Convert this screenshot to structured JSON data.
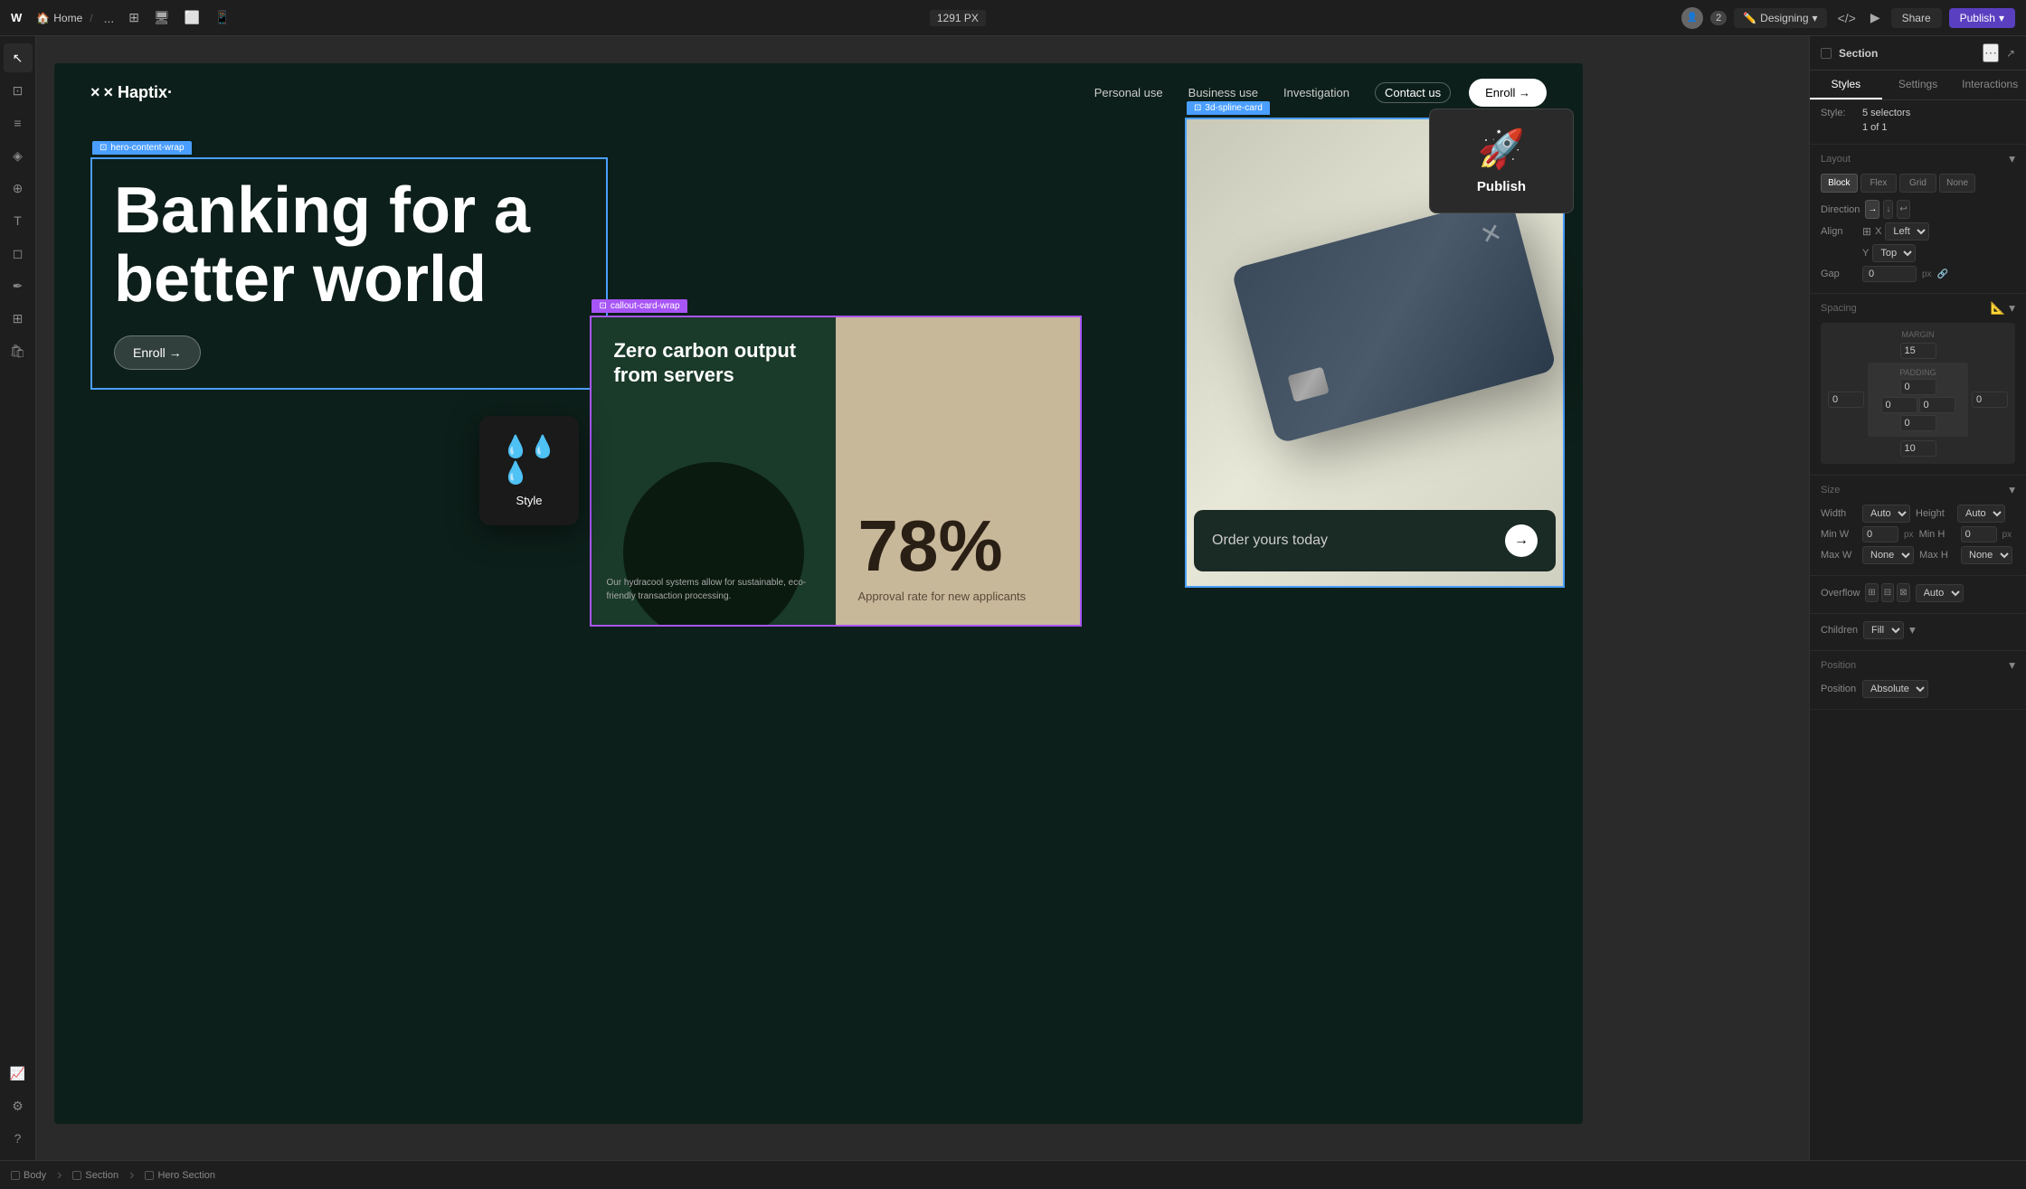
{
  "topbar": {
    "logo": "W",
    "home_label": "Home",
    "more_label": "...",
    "px_label": "1291 PX",
    "user_count": "2",
    "designing_label": "Designing",
    "share_label": "Share",
    "publish_label": "Publish"
  },
  "left_sidebar": {
    "icons": [
      "cursor",
      "frame",
      "layers",
      "component",
      "asset",
      "text",
      "shape",
      "pen",
      "comment",
      "plugin",
      "settings"
    ]
  },
  "canvas": {
    "selection_labels": {
      "hero_content_wrap": "hero-content-wrap",
      "callout_card_wrap": "callout-card-wrap",
      "spline_card": "3d-spline-card"
    },
    "website": {
      "nav": {
        "logo": "× Haptix·",
        "links": [
          "Personal use",
          "Business use",
          "Investigation",
          "Contact us"
        ],
        "enroll_btn": "Enroll →"
      },
      "hero": {
        "title": "Banking for a better world",
        "enroll_btn": "Enroll →"
      },
      "cards": {
        "green_card": {
          "title": "Zero carbon output from servers",
          "body": "Our hydracool systems allow for sustainable, eco-friendly transaction processing."
        },
        "tan_card": {
          "percentage": "78%",
          "label": "Approval rate for new applicants"
        },
        "order_card": {
          "text": "Order yours today",
          "btn_arrow": "→"
        }
      }
    }
  },
  "style_popup": {
    "icon": "💧💧\n💧",
    "label": "Style"
  },
  "publish_popup": {
    "icon_label": "rocket",
    "label": "Publish"
  },
  "right_panel": {
    "title": "Section",
    "tabs": [
      "Styles",
      "Settings",
      "Interactions"
    ],
    "style_selector": "5 selectors",
    "counts": {
      "one_of": "1 of 1"
    },
    "layout": {
      "title": "Layout",
      "display_options": [
        "Block",
        "Flex",
        "Grid",
        "None"
      ],
      "direction_label": "Direction",
      "align_label": "Align",
      "x_align": "Left",
      "y_align": "Top",
      "gap_label": "Gap",
      "gap_value": "0"
    },
    "spacing": {
      "title": "Spacing",
      "margin_label": "MARGIN",
      "margin_top": "15",
      "margin_right": "0",
      "margin_bottom": "10",
      "margin_left": "0",
      "padding_label": "PADDING",
      "padding_top": "0",
      "padding_right": "0",
      "padding_bottom": "0",
      "padding_left": "0"
    },
    "size": {
      "title": "Size",
      "width_label": "Width",
      "width_value": "Auto",
      "height_label": "Height",
      "height_value": "Auto",
      "min_w_label": "Min W",
      "min_w_value": "0",
      "min_h_label": "Min H",
      "min_h_value": "0",
      "max_w_label": "Max W",
      "max_w_value": "None",
      "max_h_label": "Max H",
      "max_h_value": "None"
    },
    "overflow": {
      "title": "Overflow",
      "value": "Auto"
    },
    "children": {
      "title": "Children",
      "value": "Fill"
    },
    "position": {
      "title": "Position",
      "value": "Absolute"
    }
  },
  "bottom_bar": {
    "body_label": "Body",
    "section_label": "Section",
    "hero_section_label": "Hero Section"
  }
}
